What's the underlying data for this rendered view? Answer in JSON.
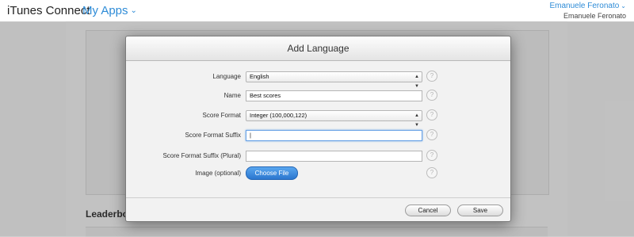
{
  "header": {
    "brand_prefix": "",
    "brand": "iTunes Connect",
    "my_apps": "My Apps",
    "user_name": "Emanuele Feronato",
    "user_sub": "Emanuele Feronato"
  },
  "background": {
    "section_heading": "Leaderboa"
  },
  "modal": {
    "title": "Add Language",
    "fields": {
      "language_label": "Language",
      "language_value": "English",
      "name_label": "Name",
      "name_value": "Best scores",
      "score_format_label": "Score Format",
      "score_format_value": "Integer (100,000,122)",
      "suffix_label": "Score Format Suffix",
      "suffix_value": "",
      "suffix_plural_label": "Score Format Suffix (Plural)",
      "suffix_plural_value": "",
      "image_label": "Image (optional)",
      "choose_file": "Choose File"
    },
    "help_glyph": "?",
    "cancel_label": "Cancel",
    "save_label": "Save"
  },
  "icons": {
    "select_arrow": "select-arrow-icon",
    "chevron": "chevron-down-icon",
    "help": "help-icon"
  },
  "colors": {
    "accent": "#2f8cd7",
    "primary_button": "#2b76cf"
  }
}
